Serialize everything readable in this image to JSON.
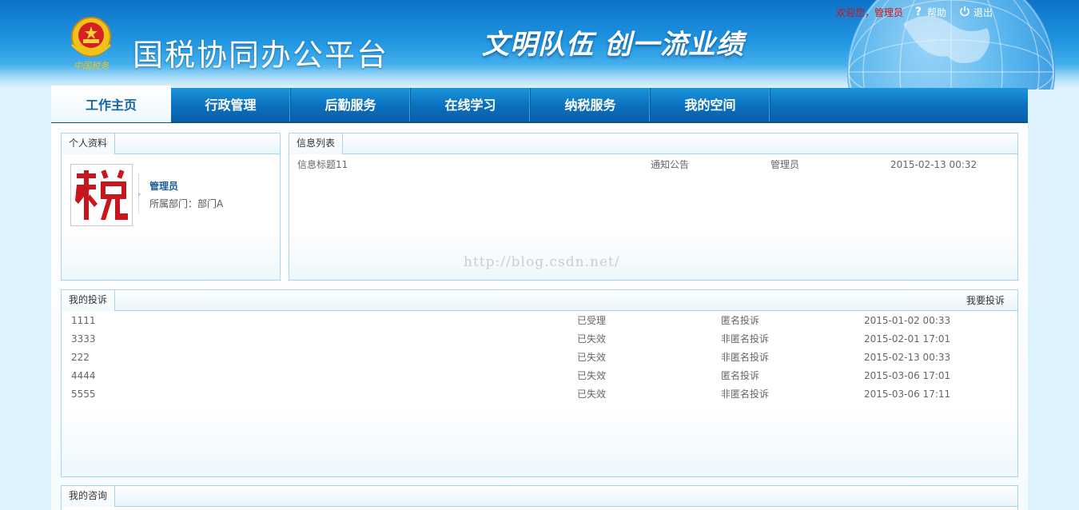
{
  "header": {
    "site_title": "国税协同办公平台",
    "slogan": "文明队伍  创一流业绩",
    "welcome": "欢迎您，管理员",
    "help_label": "帮助",
    "logout_label": "退出"
  },
  "nav": {
    "items": [
      {
        "label": "工作主页",
        "active": true
      },
      {
        "label": "行政管理",
        "active": false
      },
      {
        "label": "后勤服务",
        "active": false
      },
      {
        "label": "在线学习",
        "active": false
      },
      {
        "label": "纳税服务",
        "active": false
      },
      {
        "label": "我的空间",
        "active": false
      }
    ]
  },
  "profile": {
    "title": "个人资料",
    "avatar_icon": "tax-logo-icon",
    "name": "管理员",
    "department": "所属部门：部门A"
  },
  "info_list": {
    "title": "信息列表",
    "rows": [
      {
        "title": "信息标题11",
        "type": "通知公告",
        "author": "管理员",
        "time": "2015-02-13 00:32"
      }
    ]
  },
  "complaints": {
    "title": "我的投诉",
    "action_label": "我要投诉",
    "rows": [
      {
        "title": "1111",
        "status": "已受理",
        "type": "匿名投诉",
        "time": "2015-01-02 00:33"
      },
      {
        "title": "3333",
        "status": "已失效",
        "type": "非匿名投诉",
        "time": "2015-02-01 17:01"
      },
      {
        "title": "222",
        "status": "已失效",
        "type": "非匿名投诉",
        "time": "2015-02-13 00:33"
      },
      {
        "title": "4444",
        "status": "已失效",
        "type": "匿名投诉",
        "time": "2015-03-06 17:01"
      },
      {
        "title": "5555",
        "status": "已失效",
        "type": "非匿名投诉",
        "time": "2015-03-06 17:11"
      }
    ]
  },
  "consult": {
    "title": "我的咨询"
  },
  "watermark": "http://blog.csdn.net/",
  "colors": {
    "accent": "#0b6fbd",
    "welcome_red": "#d4111a",
    "panel_border": "#a8d3ee",
    "page_bg": "#ddf2fc"
  }
}
